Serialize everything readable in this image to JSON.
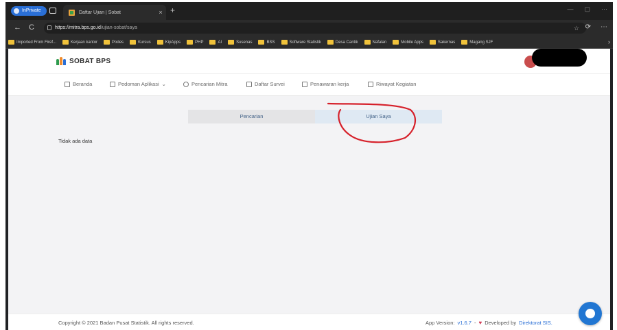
{
  "browser": {
    "inprivate_label": "InPrivate",
    "tab_title": "Daftar Ujian | Sobat",
    "tab_close": "×",
    "new_tab": "+",
    "window_controls": [
      "—",
      "▢",
      "⋯"
    ],
    "back": "←",
    "reload": "C",
    "url_host": "https://mitra.bps.go.id",
    "url_path": "/ujian-sobat/saya",
    "favorite_icon": "☆",
    "address_actions": [
      "⟳",
      "⋯"
    ],
    "bookmarks": [
      "Imported From Firef...",
      "Kerjaan kantor",
      "Podes",
      "Kursus",
      "KipApps",
      "PHP",
      "AI",
      "Susenas",
      "BSS",
      "Software Statistik",
      "Desa Cantik",
      "Nafalan",
      "Mobile Apps",
      "Sakernas",
      "Magang SJF"
    ],
    "bookmarks_more": "›"
  },
  "site": {
    "brand": "SOBAT BPS",
    "brand_colors": [
      "#2e9b4f",
      "#f08c2e",
      "#2a6fd6"
    ],
    "menu": [
      {
        "label": "Beranda",
        "icon": "home-icon"
      },
      {
        "label": "Pedoman Aplikasi",
        "icon": "document-icon",
        "dropdown": "⌄"
      },
      {
        "label": "Pencarian Mitra",
        "icon": "user-icon"
      },
      {
        "label": "Daftar Survei",
        "icon": "clipboard-icon"
      },
      {
        "label": "Penawaran kerja",
        "icon": "clipboard-icon"
      },
      {
        "label": "Riwayat Kegiatan",
        "icon": "clipboard-icon"
      }
    ],
    "toggle": {
      "search_label": "Pencarian",
      "mine_label": "Ujian Saya",
      "selected": "Ujian Saya"
    },
    "empty_message": "Tidak ada data",
    "footer": {
      "copyright": "Copyright © 2021 Badan Pusat Statistik. All rights reserved.",
      "version_label": "App Version:",
      "version": "v1.6.7",
      "separator": "-",
      "developed_by": "Developed by",
      "developer": "Direktorat SIS."
    }
  },
  "annotation_color": "#d6202a"
}
